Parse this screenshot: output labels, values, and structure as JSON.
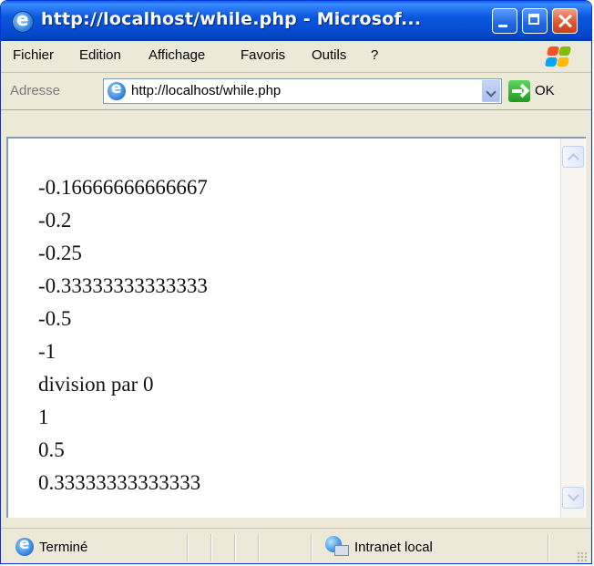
{
  "window": {
    "title": "http://localhost/while.php - Microsof..."
  },
  "menu": {
    "items": [
      "Fichier",
      "Edition",
      "Affichage",
      "Favoris",
      "Outils",
      "?"
    ]
  },
  "address_bar": {
    "label": "Adresse",
    "url": "http://localhost/while.php",
    "go_label": "OK"
  },
  "page": {
    "lines": [
      "-0.16666666666667",
      "-0.2",
      "-0.25",
      "-0.33333333333333",
      "-0.5",
      "-1",
      "division par 0",
      "1",
      "0.5",
      "0.33333333333333"
    ]
  },
  "status_bar": {
    "status_text": "Terminé",
    "zone_text": "Intranet local"
  },
  "colors": {
    "titlebar_blue": "#0546c9",
    "close_red": "#e2552d",
    "chrome_beige": "#ece9d8"
  }
}
